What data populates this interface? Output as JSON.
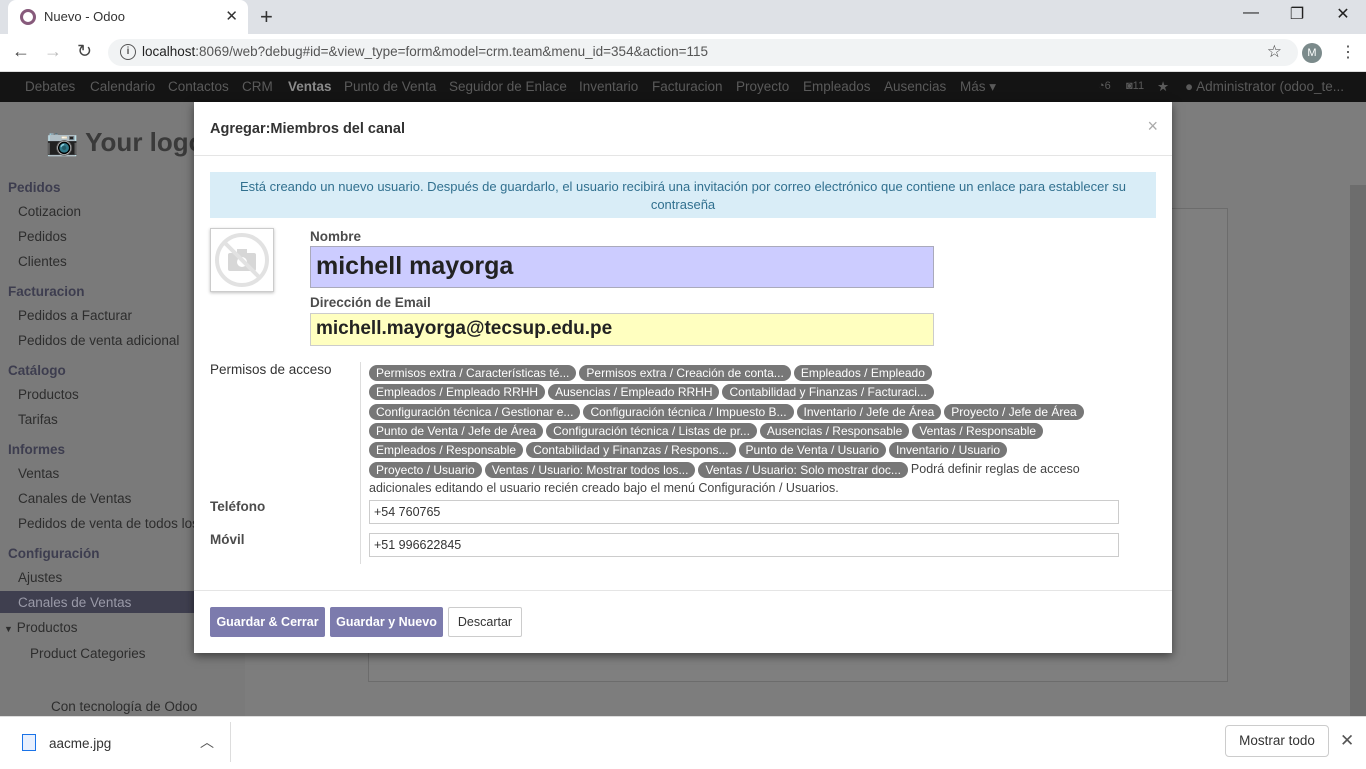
{
  "browser": {
    "tab_title": "Nuevo - Odoo",
    "new_tab": "+",
    "url_host": "localhost",
    "url_rest": ":8069/web?debug#id=&view_type=form&model=crm.team&menu_id=354&action=115",
    "profile_initial": "M"
  },
  "topnav": {
    "items": [
      "Debates",
      "Calendario",
      "Contactos",
      "CRM",
      "Ventas",
      "Punto de Venta",
      "Seguidor de Enlace",
      "Inventario",
      "Facturacion",
      "Proyecto",
      "Empleados",
      "Ausencias",
      "Más"
    ],
    "active": "Ventas",
    "badge1": "6",
    "badge2": "11",
    "user": "Administrator (odoo_te..."
  },
  "sidebar": {
    "logo": "Your logo",
    "sections": [
      {
        "title": "Pedidos",
        "items": [
          "Cotizacion",
          "Pedidos",
          "Clientes"
        ]
      },
      {
        "title": "Facturacion",
        "items": [
          "Pedidos a Facturar",
          "Pedidos de venta adicional"
        ]
      },
      {
        "title": "Catálogo",
        "items": [
          "Productos",
          "Tarifas"
        ]
      },
      {
        "title": "Informes",
        "items": [
          "Ventas",
          "Canales de Ventas",
          "Pedidos de venta de todos los"
        ]
      },
      {
        "title": "Configuración",
        "items": [
          "Ajustes",
          "Canales de Ventas",
          "Productos",
          "Product Categories"
        ]
      }
    ],
    "powered": "Con tecnología de Odoo"
  },
  "modal": {
    "title": "Agregar:Miembros del canal",
    "close": "×",
    "alert": "Está creando un nuevo usuario. Después de guardarlo, el usuario recibirá una invitación por correo electrónico que contiene un enlace para establecer su contraseña",
    "name_label": "Nombre",
    "name_value": "michell mayorga",
    "email_label": "Dirección de Email",
    "email_value": "michell.mayorga@tecsup.edu.pe",
    "access_label": "Permisos de acceso",
    "tags": [
      "Permisos extra / Características té...",
      "Permisos extra / Creación de conta...",
      "Empleados / Empleado",
      "Empleados / Empleado RRHH",
      "Ausencias / Empleado RRHH",
      "Contabilidad y Finanzas / Facturaci...",
      "Configuración técnica / Gestionar e...",
      "Configuración técnica / Impuesto B...",
      "Inventario / Jefe de Área",
      "Proyecto / Jefe de Área",
      "Punto de Venta / Jefe de Área",
      "Configuración técnica / Listas de pr...",
      "Ausencias / Responsable",
      "Ventas / Responsable",
      "Empleados / Responsable",
      "Contabilidad y Finanzas / Respons...",
      "Punto de Venta / Usuario",
      "Inventario / Usuario",
      "Proyecto / Usuario",
      "Ventas / Usuario: Mostrar todos los...",
      "Ventas / Usuario: Solo mostrar doc..."
    ],
    "access_note": "Podrá definir reglas de acceso adicionales editando el usuario recién creado bajo el menú Configuración / Usuarios.",
    "phone_label": "Teléfono",
    "phone_value": "+54 760765",
    "mobile_label": "Móvil",
    "mobile_value": "+51 996622845",
    "btn_save_close": "Guardar & Cerrar",
    "btn_save_new": "Guardar y Nuevo",
    "btn_discard": "Descartar"
  },
  "downloads": {
    "file": "aacme.jpg",
    "show_all": "Mostrar todo"
  }
}
